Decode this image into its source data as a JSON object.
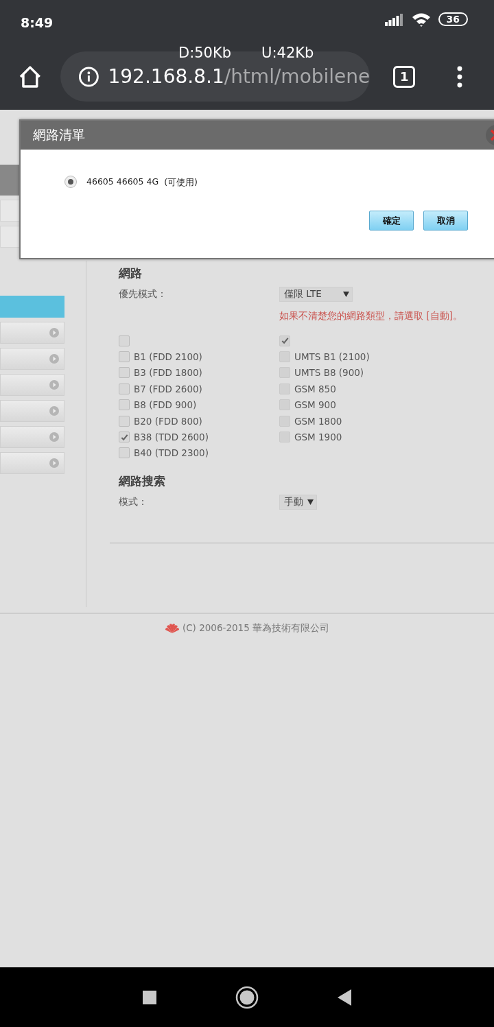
{
  "status_bar": {
    "time": "8:49",
    "battery": "36"
  },
  "browser": {
    "download": "D:50Kb",
    "upload": "U:42Kb",
    "url_host": "192.168.8.1",
    "url_path": "/html/mobilene",
    "tab_count": "1"
  },
  "sidebar": {
    "items": [
      {
        "kind": "header",
        "selected": false
      },
      {
        "kind": "plain",
        "selected": false
      },
      {
        "kind": "plain",
        "selected": false
      },
      {
        "kind": "plain",
        "selected": true
      },
      {
        "kind": "arrow",
        "selected": false
      },
      {
        "kind": "arrow",
        "selected": false
      },
      {
        "kind": "arrow",
        "selected": false
      },
      {
        "kind": "arrow",
        "selected": false
      },
      {
        "kind": "arrow",
        "selected": false
      },
      {
        "kind": "arrow",
        "selected": false
      }
    ]
  },
  "network": {
    "title": "網路",
    "preferred_mode": {
      "label": "優先模式：",
      "value": "僅限 LTE"
    },
    "hint": "如果不清楚您的網路類型，請選取 [自動]。",
    "lte_all": {
      "checked": false,
      "disabled": false
    },
    "other_all": {
      "checked": true,
      "disabled": true
    },
    "lte_bands": [
      {
        "label": "B1 (FDD 2100)",
        "checked": false,
        "disabled": false
      },
      {
        "label": "B3 (FDD 1800)",
        "checked": false,
        "disabled": false
      },
      {
        "label": "B7 (FDD 2600)",
        "checked": false,
        "disabled": false
      },
      {
        "label": "B8 (FDD 900)",
        "checked": false,
        "disabled": false
      },
      {
        "label": "B20 (FDD 800)",
        "checked": false,
        "disabled": false
      },
      {
        "label": "B38 (TDD 2600)",
        "checked": true,
        "disabled": false
      },
      {
        "label": "B40 (TDD 2300)",
        "checked": false,
        "disabled": false
      }
    ],
    "other_bands": [
      {
        "label": "UMTS B1 (2100)",
        "checked": false,
        "disabled": true
      },
      {
        "label": "UMTS B8 (900)",
        "checked": false,
        "disabled": true
      },
      {
        "label": "GSM 850",
        "checked": false,
        "disabled": true
      },
      {
        "label": "GSM 900",
        "checked": false,
        "disabled": true
      },
      {
        "label": "GSM 1800",
        "checked": false,
        "disabled": true
      },
      {
        "label": "GSM 1900",
        "checked": false,
        "disabled": true
      }
    ]
  },
  "network_search": {
    "title": "網路搜索",
    "mode": {
      "label": "模式：",
      "value": "手動"
    }
  },
  "footer": "(C) 2006-2015 華為技術有限公司",
  "dialog": {
    "title": "網路清單",
    "networks": [
      {
        "label": "46605 46605 4G",
        "status": "(可使用)",
        "selected": true
      }
    ],
    "buttons": [
      "確定",
      "取消"
    ]
  }
}
